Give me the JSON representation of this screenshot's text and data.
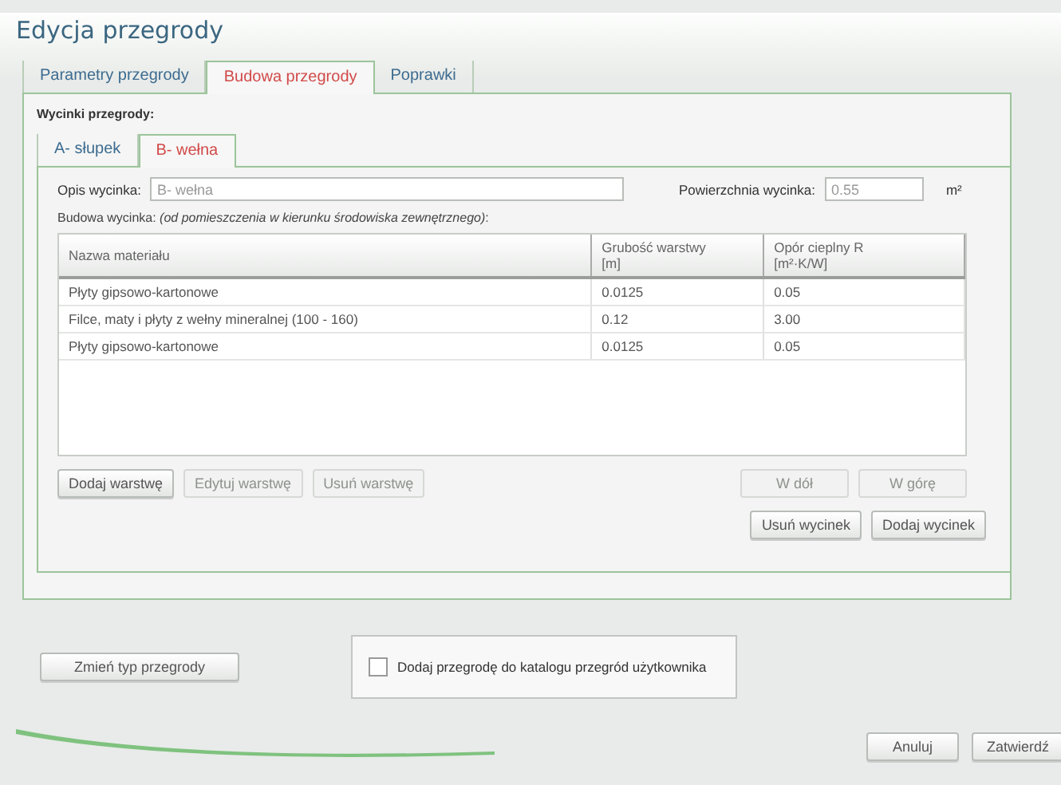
{
  "window": {
    "title": "Edycja przegrody"
  },
  "tabs": [
    {
      "label": "Parametry przegrody",
      "selected": false
    },
    {
      "label": "Budowa przegrody",
      "selected": true
    },
    {
      "label": "Poprawki",
      "selected": false
    }
  ],
  "section_label": "Wycinki przegrody:",
  "segment_tabs": [
    {
      "label": "A- słupek",
      "selected": false
    },
    {
      "label": "B- wełna",
      "selected": true
    }
  ],
  "description": {
    "label": "Opis wycinka:",
    "value": "B- wełna"
  },
  "area": {
    "label": "Powierzchnia wycinka:",
    "value": "0.55",
    "unit": "m²"
  },
  "layers_caption": "Budowa wycinka:  *(od pomieszczenia w kierunku środowiska zewnętrznego)*:",
  "table": {
    "columns": [
      {
        "label": "Nazwa materiału"
      },
      {
        "label": "Grubość warstwy",
        "unit": "[m]"
      },
      {
        "label": "Opór cieplny R",
        "unit": "[m²·K/W]"
      }
    ],
    "rows": [
      [
        "Płyty gipsowo-kartonowe",
        "0.0125",
        "0.05"
      ],
      [
        "Filce, maty i płyty z wełny mineralnej (100 - 160)",
        "0.12",
        "3.00"
      ],
      [
        "Płyty gipsowo-kartonowe",
        "0.0125",
        "0.05"
      ]
    ]
  },
  "layer_buttons": [
    {
      "label": "Dodaj warstwę",
      "disabled": false
    },
    {
      "label": "Edytuj warstwę",
      "disabled": true
    },
    {
      "label": "Usuń warstwę",
      "disabled": true
    }
  ],
  "move_buttons": [
    {
      "label": "W dół",
      "disabled": true
    },
    {
      "label": "W górę",
      "disabled": true
    }
  ],
  "segment_buttons": [
    {
      "label": "Usuń wycinek",
      "disabled": false
    },
    {
      "label": "Dodaj wycinek",
      "disabled": false
    }
  ],
  "change_type_button": {
    "label": "Zmień typ przegrody",
    "disabled": false
  },
  "catalog_checkbox": {
    "label": "Dodaj przegrodę do katalogu przegród użytkownika",
    "checked": false
  },
  "dialog_buttons": [
    {
      "label": "Anuluj",
      "disabled": false
    },
    {
      "label": "Zatwierdź",
      "disabled": false
    }
  ]
}
